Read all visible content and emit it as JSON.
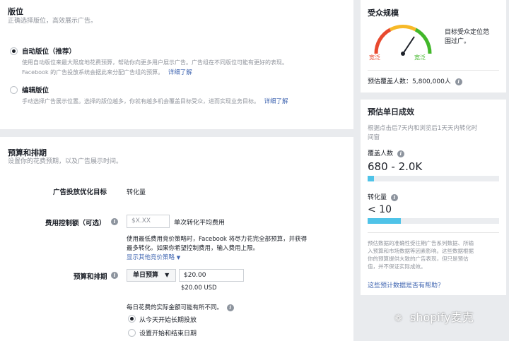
{
  "placements": {
    "title": "版位",
    "subtitle": "正确选择版位，高效展示广告。",
    "auto": {
      "label": "自动版位（推荐）",
      "desc_line1": "使用自动版位来最大限度地花费预算，帮助你向更多用户展示广告。广告组在不同版位可能有更好的表现。",
      "desc_line2": "Facebook 的广告投放系统会据此来分配广告组的预算。",
      "link": "详细了解"
    },
    "edit": {
      "label": "编辑版位",
      "desc": "手动选择广告展示位置。选择的版位越多，你就有越多机会覆盖目标受众，进而实现业务目标。",
      "link": "详细了解"
    }
  },
  "budget": {
    "title": "预算和排期",
    "subtitle": "设置你的花费预期，以及广告展示时间。",
    "goal_label": "广告投放优化目标",
    "goal_value": "转化量",
    "cost_label": "费用控制额（可选）",
    "cost_placeholder": "$X.XX",
    "cost_suffix": "单次转化平均费用",
    "cost_help_line1": "使用最低费用竞价策略时，Facebook 将尽力花完全部预算，并获得",
    "cost_help_line2": "最多转化。如果你希望控制费用，输入费用上限。",
    "show_more": "显示其他竞价策略",
    "schedule_label": "预算和排期",
    "budget_type": "单日预算",
    "budget_amount": "$20.00",
    "budget_usd": "$20.00 USD",
    "daily_note": "每日花费的实际金额可能有所不同。",
    "option_run": "从今天开始长期投放",
    "option_dates": "设置开始和结束日期"
  },
  "audience": {
    "title": "受众规模",
    "gauge_left": "宽泛",
    "gauge_right": "宽泛",
    "desc_line1": "目标受众定位范",
    "desc_line2": "围过广。",
    "reach_text": "预估覆盖人数：5,800,000人",
    "colors": {
      "gauge_red": "#e8492f",
      "gauge_yellow": "#f7b928",
      "gauge_green": "#42b72a"
    }
  },
  "daily": {
    "title": "预估单日成效",
    "desc_line1": "根据点击后7天内和浏览后1天天内转化时",
    "desc_line2": "间窗",
    "reach_label": "覆盖人数",
    "reach_value": "680 - 2.0K",
    "reach_fill": 0.05,
    "conv_label": "转化量",
    "conv_value": "< 10",
    "conv_fill": 0.25,
    "note_line1": "预估数据的准确性受往期广告系列数据、所输",
    "note_line2": "入预算和市场数据等因素影响。这些数据根据",
    "note_line3": "你的预算提供大致的广告表现，但只是预估",
    "note_line4": "值，并不保证实际成效。",
    "helpful_link": "这些预计数据是否有帮助？"
  },
  "watermark": {
    "text": "shopify麦克"
  }
}
